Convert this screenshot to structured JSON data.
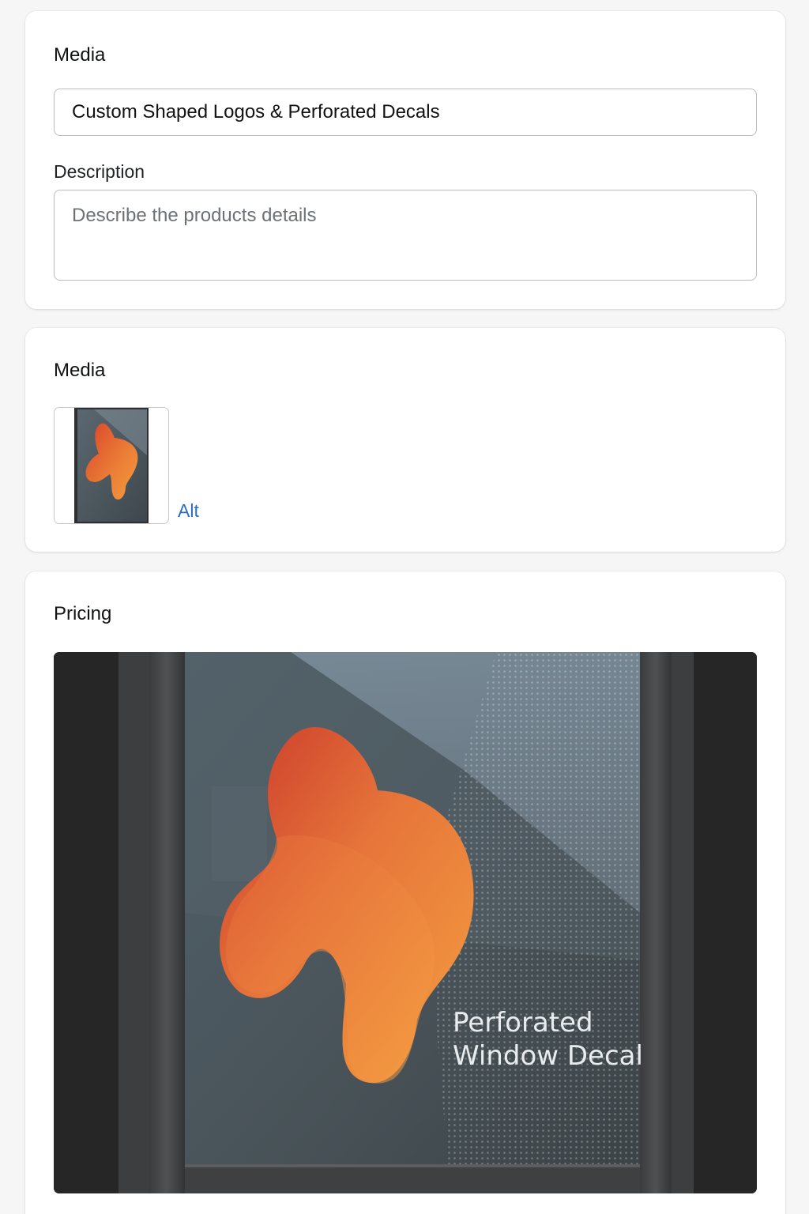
{
  "card1": {
    "heading": "Media",
    "title_value": "Custom Shaped Logos & Perforated Decals",
    "description_label": "Description",
    "description_placeholder": "Describe the products details"
  },
  "card2": {
    "heading": "Media",
    "thumbnail_icon": "window-decal-thumbnail",
    "alt_label": "Alt"
  },
  "card3": {
    "heading": "Pricing",
    "image_caption_line1": "Perforated",
    "image_caption_line2": "Window Decal"
  },
  "colors": {
    "page_bg": "#f6f6f7",
    "card_bg": "#ffffff",
    "link": "#2c6ecb",
    "decal_orange": "#f0963a",
    "decal_red": "#d9442b"
  }
}
